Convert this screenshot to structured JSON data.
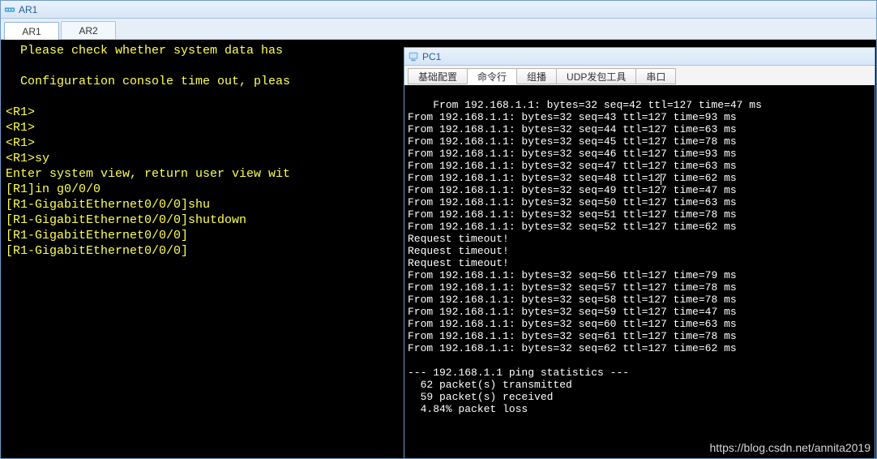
{
  "ar1": {
    "title": "AR1",
    "tabs": [
      "AR1",
      "AR2"
    ],
    "active_tab": 0,
    "lines": [
      "  Please check whether system data has ",
      "",
      "  Configuration console time out, pleas",
      "",
      "<R1>",
      "<R1>",
      "<R1>",
      "<R1>sy",
      "Enter system view, return user view wit",
      "[R1]in g0/0/0",
      "[R1-GigabitEthernet0/0/0]shu",
      "[R1-GigabitEthernet0/0/0]shutdown",
      "[R1-GigabitEthernet0/0/0]",
      "[R1-GigabitEthernet0/0/0]"
    ]
  },
  "pc1": {
    "title": "PC1",
    "tabs": [
      "基础配置",
      "命令行",
      "组播",
      "UDP发包工具",
      "串口"
    ],
    "active_tab": 1,
    "lines": [
      "From 192.168.1.1: bytes=32 seq=42 ttl=127 time=47 ms",
      "From 192.168.1.1: bytes=32 seq=43 ttl=127 time=93 ms",
      "From 192.168.1.1: bytes=32 seq=44 ttl=127 time=63 ms",
      "From 192.168.1.1: bytes=32 seq=45 ttl=127 time=78 ms",
      "From 192.168.1.1: bytes=32 seq=46 ttl=127 time=93 ms",
      "From 192.168.1.1: bytes=32 seq=47 ttl=127 time=63 ms",
      "From 192.168.1.1: bytes=32 seq=48 ttl=127 time=62 ms",
      "From 192.168.1.1: bytes=32 seq=49 ttl=127 time=47 ms",
      "From 192.168.1.1: bytes=32 seq=50 ttl=127 time=63 ms",
      "From 192.168.1.1: bytes=32 seq=51 ttl=127 time=78 ms",
      "From 192.168.1.1: bytes=32 seq=52 ttl=127 time=62 ms",
      "Request timeout!",
      "Request timeout!",
      "Request timeout!",
      "From 192.168.1.1: bytes=32 seq=56 ttl=127 time=79 ms",
      "From 192.168.1.1: bytes=32 seq=57 ttl=127 time=78 ms",
      "From 192.168.1.1: bytes=32 seq=58 ttl=127 time=78 ms",
      "From 192.168.1.1: bytes=32 seq=59 ttl=127 time=47 ms",
      "From 192.168.1.1: bytes=32 seq=60 ttl=127 time=63 ms",
      "From 192.168.1.1: bytes=32 seq=61 ttl=127 time=78 ms",
      "From 192.168.1.1: bytes=32 seq=62 ttl=127 time=62 ms",
      "",
      "--- 192.168.1.1 ping statistics ---",
      "  62 packet(s) transmitted",
      "  59 packet(s) received",
      "  4.84% packet loss"
    ]
  },
  "watermark": "https://blog.csdn.net/annita2019"
}
